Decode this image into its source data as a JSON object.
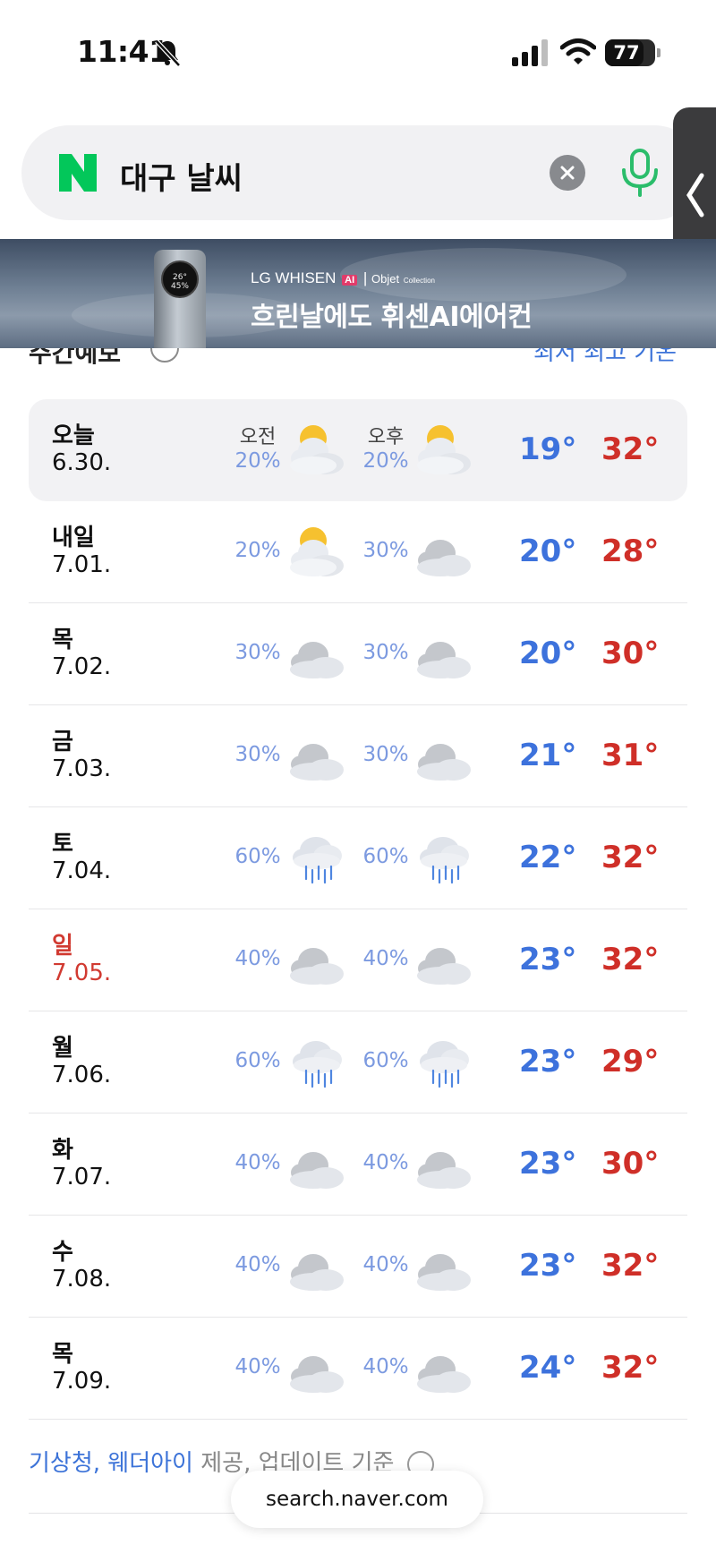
{
  "status_bar": {
    "time": "11:41",
    "battery": "77"
  },
  "search": {
    "query": "대구 날씨"
  },
  "banner": {
    "brand": "LG WHISEN",
    "brand_ai": "AI",
    "brand_sub": "Objet",
    "brand_collection": "Collection",
    "tagline": "흐린날에도 휘센AI에어컨",
    "device_screen": "26° 45%"
  },
  "section": {
    "title": "주간예보",
    "link": "최저 최고 기온"
  },
  "forecast": {
    "am_label": "오전",
    "pm_label": "오후",
    "days": [
      {
        "day": "오늘",
        "date": "6.30.",
        "am_pct": "20%",
        "am_icon": "partly-cloudy-icon",
        "pm_pct": "20%",
        "pm_icon": "partly-cloudy-icon",
        "low": "19°",
        "high": "32°"
      },
      {
        "day": "내일",
        "date": "7.01.",
        "am_pct": "20%",
        "am_icon": "partly-cloudy-icon",
        "pm_pct": "30%",
        "pm_icon": "cloudy-icon",
        "low": "20°",
        "high": "28°"
      },
      {
        "day": "목",
        "date": "7.02.",
        "am_pct": "30%",
        "am_icon": "cloudy-icon",
        "pm_pct": "30%",
        "pm_icon": "cloudy-icon",
        "low": "20°",
        "high": "30°"
      },
      {
        "day": "금",
        "date": "7.03.",
        "am_pct": "30%",
        "am_icon": "cloudy-icon",
        "pm_pct": "30%",
        "pm_icon": "cloudy-icon",
        "low": "21°",
        "high": "31°"
      },
      {
        "day": "토",
        "date": "7.04.",
        "am_pct": "60%",
        "am_icon": "rain-icon",
        "pm_pct": "60%",
        "pm_icon": "rain-icon",
        "low": "22°",
        "high": "32°"
      },
      {
        "day": "일",
        "date": "7.05.",
        "am_pct": "40%",
        "am_icon": "cloudy-icon",
        "pm_pct": "40%",
        "pm_icon": "cloudy-icon",
        "low": "23°",
        "high": "32°"
      },
      {
        "day": "월",
        "date": "7.06.",
        "am_pct": "60%",
        "am_icon": "rain-icon",
        "pm_pct": "60%",
        "pm_icon": "rain-icon",
        "low": "23°",
        "high": "29°"
      },
      {
        "day": "화",
        "date": "7.07.",
        "am_pct": "40%",
        "am_icon": "cloudy-icon",
        "pm_pct": "40%",
        "pm_icon": "cloudy-icon",
        "low": "23°",
        "high": "30°"
      },
      {
        "day": "수",
        "date": "7.08.",
        "am_pct": "40%",
        "am_icon": "cloudy-icon",
        "pm_pct": "40%",
        "pm_icon": "cloudy-icon",
        "low": "23°",
        "high": "32°"
      },
      {
        "day": "목",
        "date": "7.09.",
        "am_pct": "40%",
        "am_icon": "cloudy-icon",
        "pm_pct": "40%",
        "pm_icon": "cloudy-icon",
        "low": "24°",
        "high": "32°"
      }
    ]
  },
  "footer": {
    "source_link": "기상청, 웨더아이",
    "source_rest": "제공, 업데이트 기준",
    "url": "search.naver.com"
  },
  "colors": {
    "low_temp": "#3d72dc",
    "high_temp": "#cf2f28",
    "sunday": "#d13a31",
    "naver_green": "#03c75a",
    "link": "#3c73d8"
  }
}
